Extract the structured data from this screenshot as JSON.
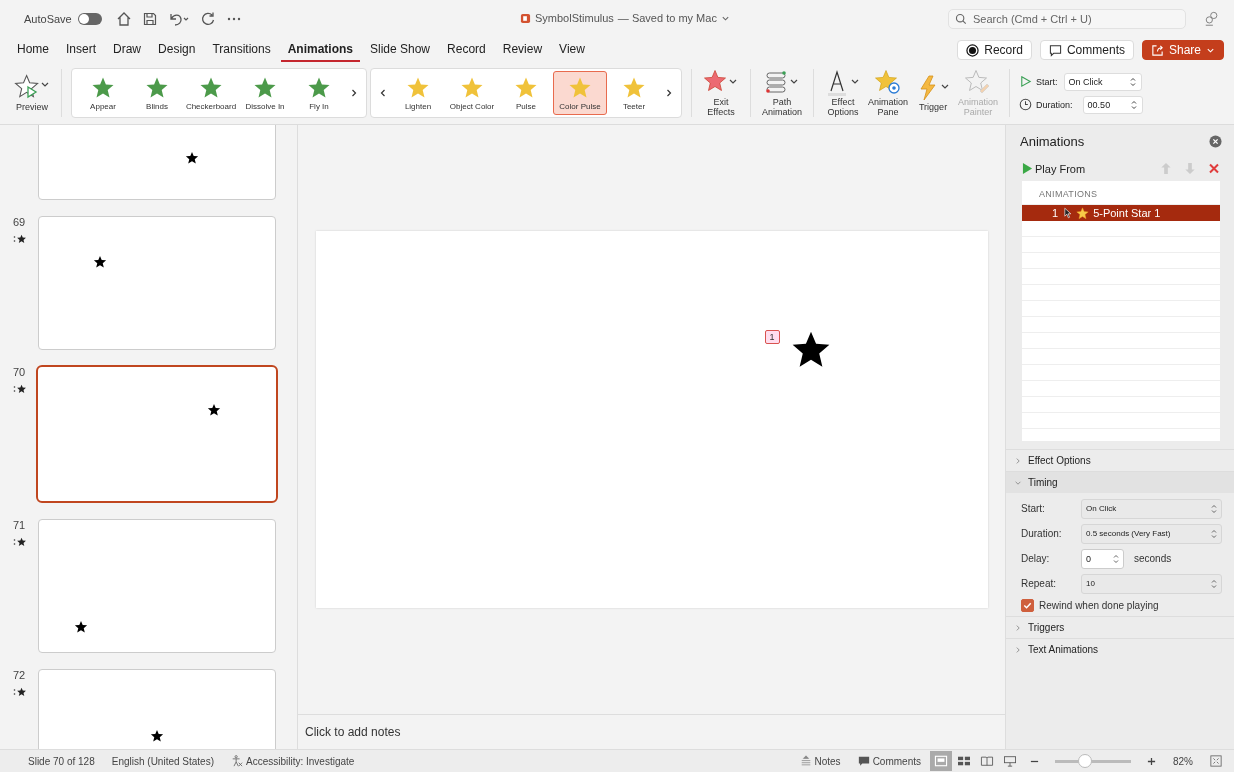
{
  "titlebar": {
    "autosave_label": "AutoSave",
    "autosave_on": false,
    "doc_title": "SymbolStimulus",
    "save_status": "— Saved to my Mac",
    "search_placeholder": "Search (Cmd + Ctrl + U)"
  },
  "tabs": [
    {
      "label": "Home",
      "selected": false
    },
    {
      "label": "Insert",
      "selected": false
    },
    {
      "label": "Draw",
      "selected": false
    },
    {
      "label": "Design",
      "selected": false
    },
    {
      "label": "Transitions",
      "selected": false
    },
    {
      "label": "Animations",
      "selected": true
    },
    {
      "label": "Slide Show",
      "selected": false
    },
    {
      "label": "Record",
      "selected": false
    },
    {
      "label": "Review",
      "selected": false
    },
    {
      "label": "View",
      "selected": false
    }
  ],
  "header_buttons": [
    {
      "label": "Record",
      "kind": "record"
    },
    {
      "label": "Comments",
      "kind": "comments"
    },
    {
      "label": "Share",
      "kind": "share"
    }
  ],
  "ribbon": {
    "preview_label": "Preview",
    "galleries": [
      {
        "kind": "entrance",
        "items": [
          {
            "label": "Appear",
            "selected": false
          },
          {
            "label": "Blinds",
            "selected": false
          },
          {
            "label": "Checkerboard",
            "selected": false
          },
          {
            "label": "Dissolve In",
            "selected": false
          },
          {
            "label": "Fly In",
            "selected": false
          }
        ]
      },
      {
        "kind": "emphasis",
        "items": [
          {
            "label": "Lighten",
            "selected": false
          },
          {
            "label": "Object Color",
            "selected": false
          },
          {
            "label": "Pulse",
            "selected": false
          },
          {
            "label": "Color Pulse",
            "selected": true
          },
          {
            "label": "Teeter",
            "selected": false
          }
        ]
      }
    ],
    "tools": [
      {
        "label": "Exit Effects",
        "kind": "exit",
        "disabled": false
      },
      {
        "label": "Path Animation",
        "kind": "path",
        "disabled": false
      },
      {
        "label": "Effect Options",
        "kind": "options",
        "disabled": false
      },
      {
        "label": "Animation Pane",
        "kind": "pane",
        "disabled": false
      },
      {
        "label": "Trigger",
        "kind": "trigger",
        "disabled": false
      },
      {
        "label": "Animation Painter",
        "kind": "painter",
        "disabled": true
      }
    ],
    "start_label": "Start:",
    "start_value": "On Click",
    "duration_label": "Duration:",
    "duration_value": "00.50"
  },
  "thumbnails": [
    {
      "selected": false
    },
    {
      "number": "69",
      "selected": false
    },
    {
      "number": "70",
      "selected": true
    },
    {
      "number": "71",
      "selected": false
    },
    {
      "number": "72",
      "selected": false
    }
  ],
  "slide": {
    "badge": "1"
  },
  "notes_placeholder": "Click to add notes",
  "animation_pane": {
    "title": "Animations",
    "play_label": "Play From",
    "list_header": "ANIMATIONS",
    "items": [
      {
        "order": "1",
        "name": "5-Point Star 1",
        "selected": true
      }
    ],
    "sections": [
      {
        "label": "Effect Options",
        "expanded": false
      },
      {
        "label": "Timing",
        "expanded": true
      },
      {
        "label": "Triggers",
        "expanded": false
      },
      {
        "label": "Text Animations",
        "expanded": false
      }
    ],
    "timing": {
      "start_label": "Start:",
      "start_value": "On Click",
      "duration_label": "Duration:",
      "duration_value": "0.5 seconds (Very Fast)",
      "delay_label": "Delay:",
      "delay_value": "0",
      "delay_unit": "seconds",
      "repeat_label": "Repeat:",
      "repeat_value": "10",
      "rewind_label": "Rewind when done playing",
      "rewind_checked": true
    }
  },
  "status_bar": {
    "slide_info": "Slide 70 of 128",
    "language": "English (United States)",
    "accessibility": "Accessibility: Investigate",
    "notes_label": "Notes",
    "comments_label": "Comments",
    "views": [
      {
        "kind": "normal",
        "selected": true
      },
      {
        "kind": "sorter",
        "selected": false
      },
      {
        "kind": "reading",
        "selected": false
      },
      {
        "kind": "slideshow",
        "selected": false
      }
    ],
    "zoom": {
      "level": 0.4
    },
    "zoom_percent": "82%"
  }
}
